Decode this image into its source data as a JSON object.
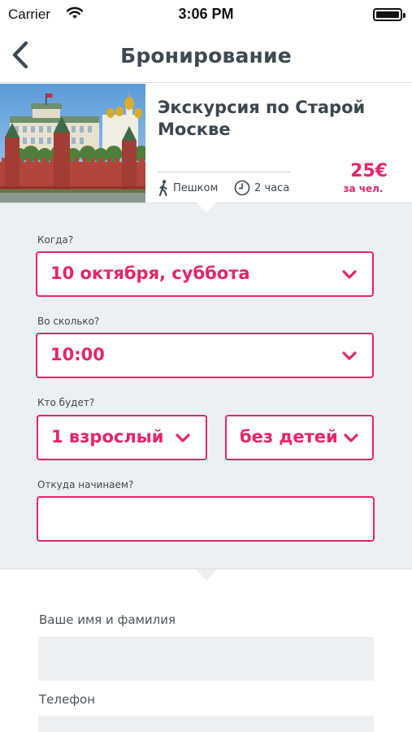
{
  "status_bar": {
    "carrier": "Carrier",
    "time": "3:06 PM"
  },
  "nav": {
    "title": "Бронирование",
    "back_icon": "chevron-left-icon"
  },
  "tour": {
    "title": "Экскурсия по Старой Москве",
    "transport": "Пешком",
    "duration": "2 часа",
    "price": "25€",
    "price_unit": "за чел."
  },
  "form": {
    "date_label": "Когда?",
    "date_value": "10 октября, суббота",
    "time_label": "Во сколько?",
    "time_value": "10:00",
    "guests_label": "Кто будет?",
    "adults_value": "1 взрослый",
    "children_value": "без детей",
    "start_label": "Откуда начинаем?",
    "start_value": ""
  },
  "contact": {
    "name_label": "Ваше имя и фамилия",
    "name_value": "",
    "phone_label": "Телефон",
    "phone_value": ""
  },
  "colors": {
    "accent": "#e8246a",
    "text": "#3a4750",
    "section_bg": "#edf0f2"
  }
}
